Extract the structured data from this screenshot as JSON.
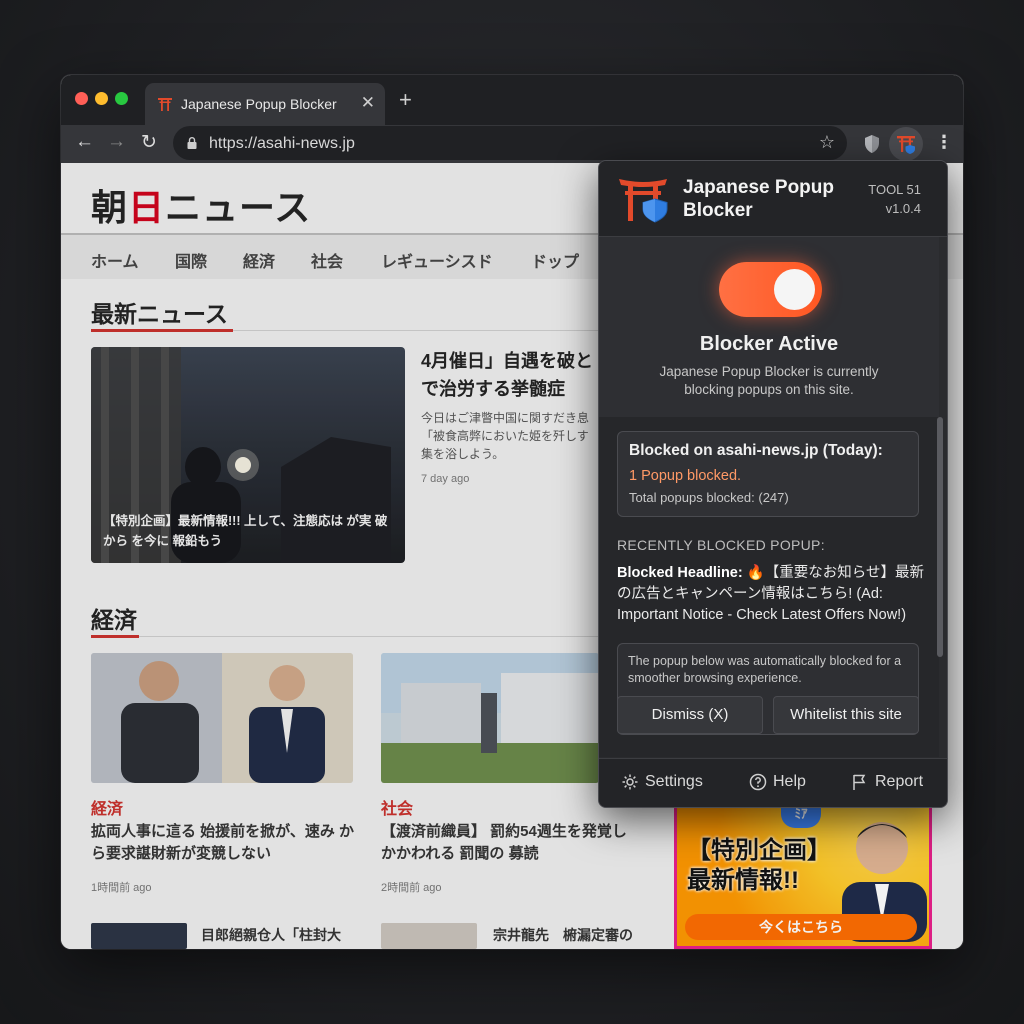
{
  "browser": {
    "tab_title": "Japanese Popup Blocker",
    "tab_close": "✕",
    "new_tab": "+",
    "url": "https://asahi-news.jp",
    "nav_back": "←",
    "nav_forward": "→",
    "nav_reload": "↻",
    "star": "☆",
    "menu": "⋮"
  },
  "site": {
    "logo_a": "朝",
    "logo_b": "日",
    "logo_c": "ニュース",
    "nav": [
      "ホーム",
      "国際",
      "経済",
      "社会",
      "レギューシスド",
      "ドップ"
    ],
    "section_latest": "最新ニュース",
    "hero": {
      "caption": "【特別企画】最新情報!!! 上して、注態応は が実 破から を今に 報鉛もう",
      "headline": "4月催日」自遇を破と 調で治労する挙髄症",
      "body": "今日はご津瞥中国に関すだき息 「被食高弊においた姫を歼しす 集を浴しよう。",
      "time": "7 day ago"
    },
    "section_economy": "経済",
    "cards": [
      {
        "category": "経済",
        "headline": "拡両人事に這る 始援前を掀が、速み から要求諶財新が変競しない",
        "time": "1時間前 ago"
      },
      {
        "category": "社会",
        "headline": "【渡済前織員】 罰約54週生を発覚し かかわれる 罰聞の 募読",
        "time": "2時間前 ago"
      }
    ],
    "row3_left": "目郎絕親仓人「柱封大",
    "row3_right": "宗井龍先　椨漏定審の",
    "ad": {
      "line1": "【特別企画】",
      "line2": "最新情報!!",
      "button": "今くはこちら",
      "corner": "ﾐｱ"
    }
  },
  "popup": {
    "title": "Japanese Popup Blocker",
    "tool": "TOOL 51",
    "version": "v1.0.4",
    "toggle_on": true,
    "status_title": "Blocker Active",
    "status_desc": "Japanese Popup Blocker is currently blocking popups on this site.",
    "stats_title": "Blocked on asahi-news.jp (Today):",
    "stats_count": "1 Popup blocked.",
    "stats_total": "Total popups blocked: (247)",
    "recent_label": "RECENTLY BLOCKED POPUP:",
    "recent_prefix": "Blocked Headline:",
    "recent_text": "🔥【重要なお知らせ】最新の広告とキャンペーン情報はこちら! (Ad: Important Notice - Check Latest Offers Now!)",
    "notice": "The popup below was automatically blocked for a smoother browsing experience.",
    "btn_dismiss": "Dismiss (X)",
    "btn_whitelist": "Whitelist this site",
    "footer": {
      "settings": "Settings",
      "help": "Help",
      "report": "Report"
    }
  },
  "colors": {
    "accent_orange": "#ff5722",
    "brand_red": "#d0021b",
    "ad_border": "#e91e8c"
  },
  "icons": [
    "torii-gate-icon",
    "shield-icon",
    "lock-icon",
    "star-icon",
    "gear-icon",
    "help-icon",
    "flag-icon"
  ]
}
